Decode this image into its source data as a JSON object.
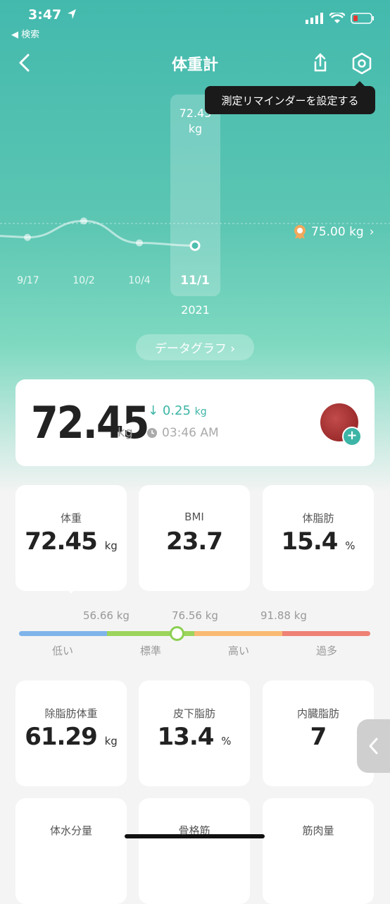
{
  "status_bar": {
    "time": "3:47",
    "back_app": "◀ 検索"
  },
  "nav": {
    "title": "体重計"
  },
  "tooltip": "測定リマインダーを設定する",
  "chart_data": {
    "type": "line",
    "x": [
      "9/17",
      "10/2",
      "10/4",
      "11/1"
    ],
    "values": [
      72.6,
      72.9,
      72.5,
      72.45
    ],
    "selected": {
      "x": "11/1",
      "value": "72.45",
      "unit": "kg"
    },
    "goal": 75.0,
    "year": "2021"
  },
  "chart": {
    "selected_value": "72.45",
    "selected_unit": "kg",
    "goal_label": "75.00 kg",
    "year": "2021",
    "x_labels": [
      "9/17",
      "10/2",
      "10/4",
      "11/1"
    ]
  },
  "data_graph_button": "データグラフ ›",
  "summary": {
    "weight": "72.45",
    "unit": "kg",
    "delta_arrow": "↓",
    "delta": "0.25",
    "delta_unit": "kg",
    "time": "03:46 AM"
  },
  "metrics_row1": [
    {
      "label": "体重",
      "value": "72.45",
      "unit": "kg"
    },
    {
      "label": "BMI",
      "value": "23.7",
      "unit": ""
    },
    {
      "label": "体脂肪",
      "value": "15.4",
      "unit": "%"
    }
  ],
  "range": {
    "thresholds": [
      "56.66 kg",
      "76.56 kg",
      "91.88 kg"
    ],
    "labels": [
      "低い",
      "標準",
      "高い",
      "過多"
    ],
    "colors": [
      "#7fb4ea",
      "#9cd45d",
      "#f9ba73",
      "#ee8275"
    ]
  },
  "metrics_row2": [
    {
      "label": "除脂肪体重",
      "value": "61.29",
      "unit": "kg"
    },
    {
      "label": "皮下脂肪",
      "value": "13.4",
      "unit": "%"
    },
    {
      "label": "内臓脂肪",
      "value": "7",
      "unit": ""
    }
  ],
  "metrics_row3": [
    {
      "label": "体水分量"
    },
    {
      "label": "骨格筋"
    },
    {
      "label": "筋肉量"
    }
  ],
  "colors": {
    "accent": "#3db5a6",
    "header_top": "#43b9ad"
  }
}
